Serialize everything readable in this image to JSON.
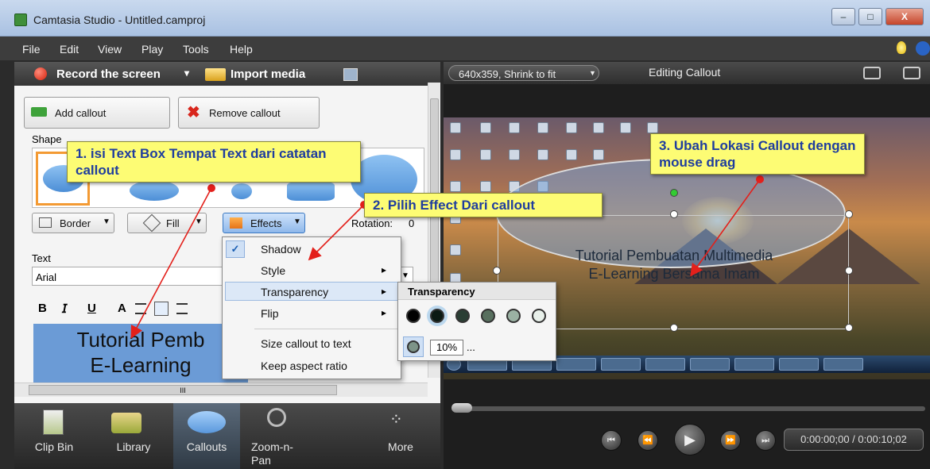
{
  "window": {
    "title": "Camtasia Studio - Untitled.camproj",
    "minimize": "–",
    "maximize": "□",
    "close": "X"
  },
  "menu": [
    "File",
    "Edit",
    "View",
    "Play",
    "Tools",
    "Help"
  ],
  "left": {
    "record": "Record the screen",
    "record_arrow": "▾",
    "import": "Import media",
    "add_callout": "Add callout",
    "remove_callout": "Remove callout",
    "shape_label": "Shape",
    "border": "Border",
    "fill": "Fill",
    "effects": "Effects",
    "rotation": "Rotation:",
    "rotation_value": "0",
    "text_label": "Text",
    "font": "Arial",
    "fmt": {
      "bold": "B",
      "italic": "𝘐",
      "underline": "U",
      "font_color": "A"
    },
    "textbox_line1": "Tutorial Pemb",
    "textbox_line2": "E-Learning",
    "scroll_h_thumb": "III"
  },
  "tabs": [
    {
      "label": "Clip Bin"
    },
    {
      "label": "Library"
    },
    {
      "label": "Callouts"
    },
    {
      "label": "Zoom-n-Pan"
    },
    {
      "label": "More"
    }
  ],
  "right": {
    "size_dropdown": "640x359, Shrink to fit",
    "editing": "Editing Callout",
    "callout_line1": "Tutorial Pembuatan Multimedia",
    "callout_line2": "E-Learning Bersama Imam",
    "time": "0:00:00;00 / 0:00:10;02"
  },
  "effects_menu": {
    "check": "✓",
    "items": [
      "Shadow",
      "Style",
      "Transparency",
      "Flip",
      "Size callout to text",
      "Keep aspect ratio"
    ],
    "arrow": "▸"
  },
  "transparency": {
    "title": "Transparency",
    "value": "10%",
    "more": "..."
  },
  "annotations": {
    "note1": "1. isi Text Box Tempat Text dari catatan callout",
    "note2": "2. Pilih Effect Dari callout",
    "note3": "3. Ubah Lokasi Callout dengan mouse drag"
  },
  "colors": {
    "note_bg": "#fdfc74",
    "note_text": "#1f3d9e",
    "arrow": "#e3201b",
    "selection": "#f39a33"
  }
}
